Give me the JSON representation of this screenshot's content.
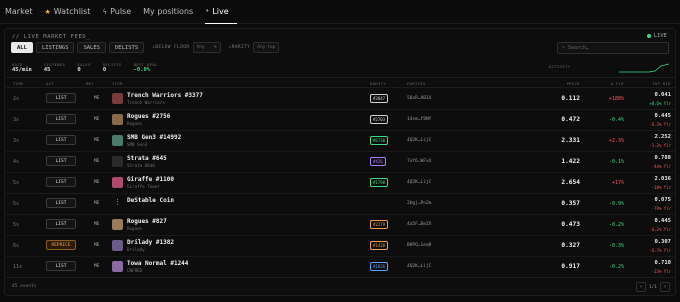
{
  "nav": {
    "tabs": [
      {
        "label": "Market",
        "icon": ""
      },
      {
        "label": "Watchlist",
        "icon": "star-icon"
      },
      {
        "label": "Pulse",
        "icon": "pulse-icon"
      },
      {
        "label": "My positions",
        "icon": ""
      },
      {
        "label": "Live",
        "icon": "dot-icon"
      }
    ],
    "active": "Live"
  },
  "feed": {
    "title": "// LIVE MARKET FEED_",
    "live_label": "LIVE",
    "filters": [
      "ALL",
      "LISTINGS",
      "SALES",
      "DELISTS"
    ],
    "active_filter": "ALL",
    "below_floor_label": "↓BELOW FLOOR",
    "below_floor_placeholder": "Any",
    "below_floor_unit": "%",
    "rarity_label": "↓RARITY",
    "rarity_placeholder": "Any",
    "rarity_unit": "top",
    "search_placeholder": "Search…"
  },
  "stats": [
    {
      "key": "RATE",
      "value": "45/min"
    },
    {
      "key": "LISTINGS",
      "value": "45"
    },
    {
      "key": "SALES",
      "value": "0"
    },
    {
      "key": "DELISTS",
      "value": "0"
    },
    {
      "key": "BEST DEAL",
      "value": "-0.0%"
    }
  ],
  "activity_label": "ACTIVITY",
  "columns": {
    "time": "TIME",
    "act": "ACT",
    "mkt": "MKT",
    "item": "ITEM",
    "rarity": "RARITY",
    "parties": "PARTIES",
    "price": "PRICE",
    "dfl": "Δ FLR",
    "topbid": "TOP BID"
  },
  "rows": [
    {
      "time": "2s",
      "act": "LIST",
      "mkt": "ME",
      "name": "Trench Warriors #3377",
      "sub": "Trench Warriors",
      "rarity": "#3847",
      "parties": "58xR…AB1X",
      "price": "0.112",
      "dfl": "+188%",
      "dfl_dir": "pos",
      "top": "0.041",
      "topsub": "+0.6% flr",
      "thumb": "#7a3a3a",
      "rcolor": "#cfcfcf"
    },
    {
      "time": "3s",
      "act": "LIST",
      "mkt": "ME",
      "name": "Rogues #2756",
      "sub": "Rogues",
      "rarity": "#2703",
      "parties": "14sm…f8NY",
      "price": "0.472",
      "dfl": "-0.4%",
      "dfl_dir": "neg",
      "top": "0.445",
      "topsub": "-6.2% flr",
      "thumb": "#8a6a4a",
      "rcolor": "#cfcfcf"
    },
    {
      "time": "3s",
      "act": "LIST",
      "mkt": "ME",
      "name": "SMB Gen3 #14992",
      "sub": "SMB Gen3",
      "rarity": "#6730",
      "parties": "4Q2K…LijC",
      "price": "2.331",
      "dfl": "+2.3%",
      "dfl_dir": "pos",
      "top": "2.252",
      "topsub": "-1.2% flr",
      "thumb": "#4a7a6a",
      "rcolor": "#3ddc84"
    },
    {
      "time": "4s",
      "act": "LIST",
      "mkt": "ME",
      "name": "Strata #645",
      "sub": "Strata 8848",
      "rarity": "#426",
      "parties": "7xY6…WFxX",
      "price": "1.422",
      "dfl": "-0.1%",
      "dfl_dir": "neg",
      "top": "0.788",
      "topsub": "-44% flr",
      "thumb": "#2a2a2a",
      "rcolor": "#b07cff"
    },
    {
      "time": "5s",
      "act": "LIST",
      "mkt": "ME",
      "name": "Giraffe #1100",
      "sub": "Giraffe Tower",
      "rarity": "#1790",
      "parties": "4Q2K…LijC",
      "price": "2.654",
      "dfl": "+17%",
      "dfl_dir": "pos",
      "top": "2.036",
      "topsub": "-10% flr",
      "thumb": "#b04a6a",
      "rcolor": "#3ddc84"
    },
    {
      "time": "5s",
      "act": "LIST",
      "mkt": "ME",
      "name": "DeStable Coin",
      "sub": "",
      "rarity": "",
      "parties": "2bgj…Pn2m",
      "price": "0.357",
      "dfl": "-0.9%",
      "dfl_dir": "neg",
      "top": "0.075",
      "topsub": "-79% flr",
      "thumb": "#0d0d0d",
      "rcolor": "#cfcfcf"
    },
    {
      "time": "5s",
      "act": "LIST",
      "mkt": "ME",
      "name": "Rogues #827",
      "sub": "Rogues",
      "rarity": "#2279",
      "parties": "4a5F…BeZX",
      "price": "0.473",
      "dfl": "-0.2%",
      "dfl_dir": "neg",
      "top": "0.445",
      "topsub": "-6.2% flr",
      "thumb": "#9a7a5a",
      "rcolor": "#f0a04b"
    },
    {
      "time": "6s",
      "act": "REPRICE",
      "mkt": "ME",
      "name": "Drilady #1382",
      "sub": "Drilady",
      "rarity": "#1428",
      "parties": "BKPQ…1eq9",
      "price": "0.327",
      "dfl": "-0.3%",
      "dfl_dir": "neg",
      "top": "0.307",
      "topsub": "-6.7% flr",
      "thumb": "#6a5a8a",
      "rcolor": "#f0a04b"
    },
    {
      "time": "11s",
      "act": "LIST",
      "mkt": "ME",
      "name": "Towa Normal #1244",
      "sub": "CNFRED",
      "rarity": "#1826",
      "parties": "4Q2K…LijC",
      "price": "0.917",
      "dfl": "-0.2%",
      "dfl_dir": "neg",
      "top": "0.710",
      "topsub": "-23% flr",
      "thumb": "#8a6aa0",
      "rcolor": "#5aa0ff"
    }
  ],
  "footer": {
    "count": "45 events",
    "page": "1/1"
  }
}
